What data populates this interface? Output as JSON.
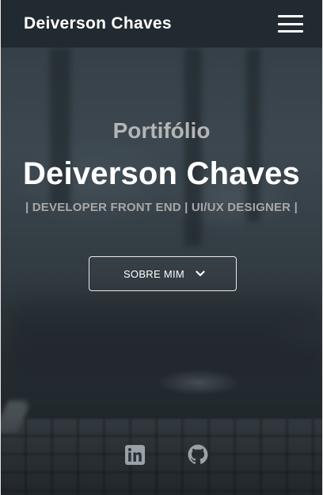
{
  "navbar": {
    "brand": "Deiverson Chaves",
    "menu_icon": "hamburger-menu-icon"
  },
  "hero": {
    "kicker": "Portifólio",
    "title": "Deiverson Chaves",
    "subtitle": "| DEVELOPER FRONT END | UI/UX DESIGNER |"
  },
  "cta": {
    "label": "SOBRE MIM",
    "icon": "chevron-down-icon"
  },
  "social": {
    "links": [
      {
        "icon": "linkedin-icon"
      },
      {
        "icon": "github-icon"
      }
    ]
  },
  "colors": {
    "navbar_bg": "#212a30",
    "text_primary": "#ffffff",
    "text_muted": "#a8a8a8",
    "icon_color": "#9aa2a8"
  }
}
